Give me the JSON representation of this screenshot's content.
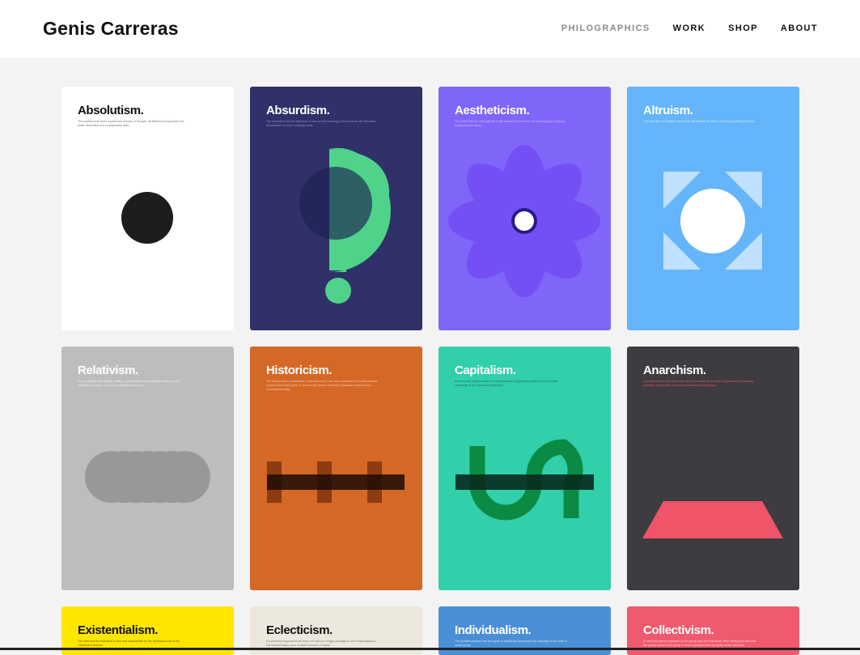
{
  "header": {
    "title": "Genis Carreras",
    "nav": [
      {
        "label": "PHILOGRAPHICS",
        "active": true
      },
      {
        "label": "WORK",
        "active": false
      },
      {
        "label": "SHOP",
        "active": false
      },
      {
        "label": "ABOUT",
        "active": false
      }
    ]
  },
  "posters": [
    {
      "title": "Absolutism.",
      "description": "The position that when a particular domain of thought, all different perspectives are either absolutely true or absolutely false.",
      "bg": "#ffffff",
      "title_color": "#111111",
      "desc_color": "#777777",
      "graphic": "black-circle"
    },
    {
      "title": "Absurdism.",
      "description": "The conviction that the attempts of man to find meaning in the universe will ultimately fail because no such meaning exists.",
      "bg": "#2f3168",
      "title_color": "#ffffff",
      "desc_color": "#8f91c4",
      "graphic": "question-mark"
    },
    {
      "title": "Aestheticism.",
      "description": "The belief that the main attitude to life should be the search for meaning and enjoying beauty in pure forms.",
      "bg": "#8065f9",
      "title_color": "#ffffff",
      "desc_color": "#c9bcff",
      "graphic": "flower"
    },
    {
      "title": "Altruism.",
      "description": "The principle of unselfish concern for the welfare of others, everything nothing in return.",
      "bg": "#64b5fa",
      "title_color": "#ffffff",
      "desc_color": "#d4eaff",
      "graphic": "sun-corners"
    },
    {
      "title": "Relativism.",
      "description": "The conviction that all truth, beliefs, and standards of morality are relative to the individual or culture, and so no absolute truths exist.",
      "bg": "#bdbdbd",
      "title_color": "#ffffff",
      "desc_color": "#eeeeee",
      "graphic": "overlapping-circles"
    },
    {
      "title": "Historicism.",
      "description": "The theory that to understand a historical event, we must understand the philosophical context that it took place in, since every person is within a particular historical and conventional stage.",
      "bg": "#d46827",
      "title_color": "#ffffff",
      "desc_color": "#f3c8aa",
      "graphic": "timeline-bars"
    },
    {
      "title": "Capitalism.",
      "description": "An economic system based on the production of goods for profit, and the private ownership of the means of production.",
      "bg": "#31cfaa",
      "title_color": "#ffffff",
      "desc_color": "#1b6f58",
      "graphic": "dollar-sign"
    },
    {
      "title": "Anarchism.",
      "description": "A political theory that rejects the idea of the state as a means of government, favoring voluntary cooperation and free association of individuals.",
      "bg": "#3e3c40",
      "title_color": "#ffffff",
      "desc_color": "#ef5468",
      "graphic": "trapezoid"
    },
    {
      "title": "Existentialism.",
      "description": "The view that the individual is free and responsible for the consequences of the individual's choices.",
      "bg": "#ffe600",
      "title_color": "#111111",
      "desc_color": "#6b6000",
      "graphic": "none"
    },
    {
      "title": "Eclecticism.",
      "description": "A conceptual approach that does not hold to a single paradigm or set of assumptions, but instead draws upon multiple theories or styles.",
      "bg": "#ece8de",
      "title_color": "#111111",
      "desc_color": "#7a776f",
      "graphic": "none"
    },
    {
      "title": "Individualism.",
      "description": "The political doctrine that the rights of individuals supersede the authority of the state or social group.",
      "bg": "#4a8fd6",
      "title_color": "#ffffff",
      "desc_color": "#cfe1f5",
      "graphic": "none"
    },
    {
      "title": "Collectivism.",
      "description": "A view that places emphasis on the group over the individual, often valuing the idea that the greater good of the group is more important than the goals of the individual.",
      "bg": "#ef5a6e",
      "title_color": "#ffffff",
      "desc_color": "#ffd3d9",
      "graphic": "none"
    }
  ]
}
